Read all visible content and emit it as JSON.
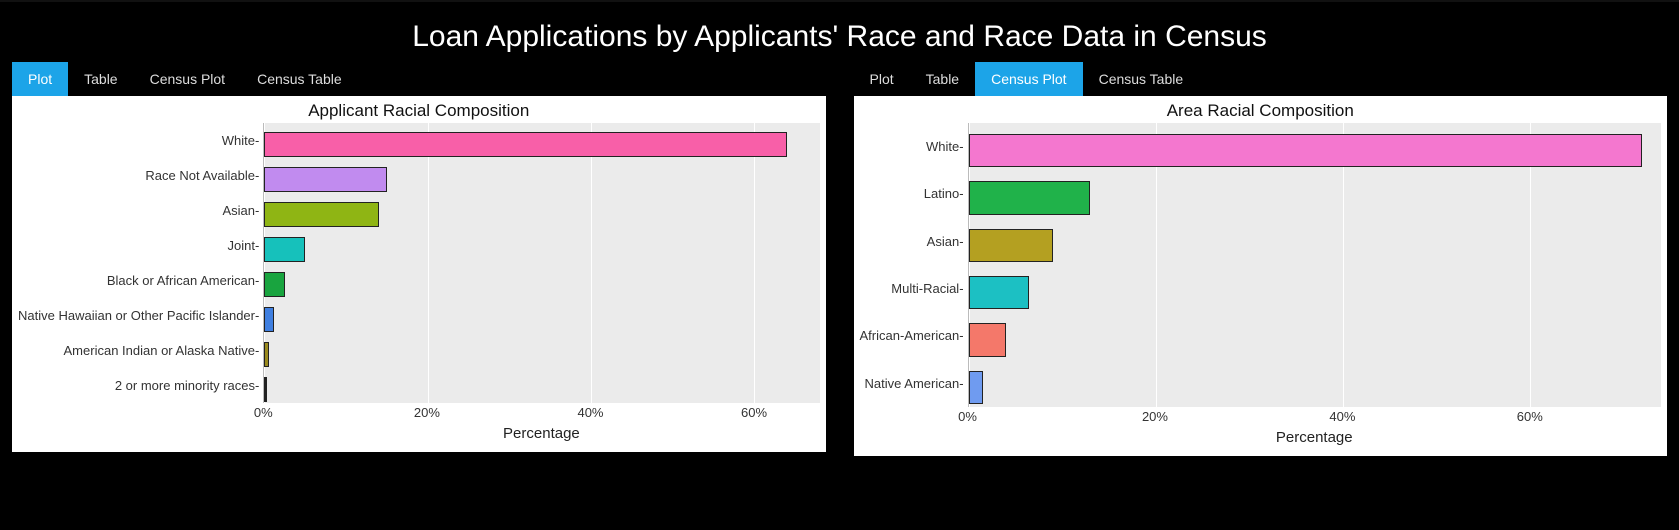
{
  "page_title": "Loan Applications by Applicants' Race and Race Data in Census",
  "left_panel": {
    "tabs": [
      {
        "label": "Plot",
        "active": true
      },
      {
        "label": "Table",
        "active": false
      },
      {
        "label": "Census Plot",
        "active": false
      },
      {
        "label": "Census Table",
        "active": false
      }
    ],
    "chart_title": "Applicant Racial Composition",
    "xlabel": "Percentage"
  },
  "right_panel": {
    "tabs": [
      {
        "label": "Plot",
        "active": false
      },
      {
        "label": "Table",
        "active": false
      },
      {
        "label": "Census Plot",
        "active": true
      },
      {
        "label": "Census Table",
        "active": false
      }
    ],
    "chart_title": "Area Racial Composition",
    "xlabel": "Percentage"
  },
  "chart_data": [
    {
      "id": "left",
      "type": "bar",
      "orientation": "horizontal",
      "title": "Applicant Racial Composition",
      "xlabel": "Percentage",
      "ylabel": "",
      "xlim": [
        0,
        68
      ],
      "xticks": [
        0,
        20,
        40,
        60
      ],
      "xtick_labels": [
        "0%",
        "20%",
        "40%",
        "60%"
      ],
      "categories": [
        "White",
        "Race Not Available",
        "Asian",
        "Joint",
        "Black or African American",
        "Native Hawaiian or Other Pacific Islander",
        "American Indian or Alaska Native",
        "2 or more minority races"
      ],
      "values": [
        64,
        15,
        14,
        5,
        2.5,
        1.2,
        0.6,
        0.3
      ],
      "colors": [
        "#f85fa8",
        "#c18bef",
        "#8fb514",
        "#16c1bb",
        "#19a43f",
        "#3f7fe0",
        "#9a8a1e",
        "#222222"
      ]
    },
    {
      "id": "right",
      "type": "bar",
      "orientation": "horizontal",
      "title": "Area Racial Composition",
      "xlabel": "Percentage",
      "ylabel": "",
      "xlim": [
        0,
        74
      ],
      "xticks": [
        0,
        20,
        40,
        60
      ],
      "xtick_labels": [
        "0%",
        "20%",
        "40%",
        "60%"
      ],
      "categories": [
        "White",
        "Latino",
        "Asian",
        "Multi-Racial",
        "African-American",
        "Native American"
      ],
      "values": [
        72,
        13,
        9,
        6.5,
        4,
        1.5
      ],
      "colors": [
        "#f477cf",
        "#20b24a",
        "#b4a021",
        "#1cc0c3",
        "#f4786a",
        "#6f9bf0"
      ]
    }
  ]
}
